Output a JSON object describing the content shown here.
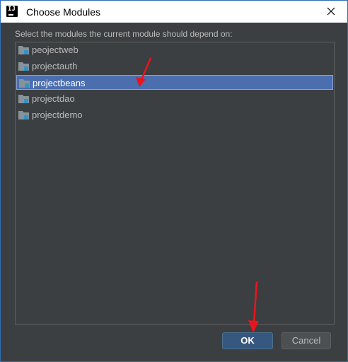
{
  "window": {
    "title": "Choose Modules",
    "app_icon_letter": "IJ"
  },
  "dialog": {
    "instruction": "Select the modules the current module should depend on:",
    "modules": [
      {
        "label": "peojectweb",
        "selected": false
      },
      {
        "label": "projectauth",
        "selected": false
      },
      {
        "label": "projectbeans",
        "selected": true
      },
      {
        "label": "projectdao",
        "selected": false
      },
      {
        "label": "projectdemo",
        "selected": false
      }
    ],
    "ok_label": "OK",
    "cancel_label": "Cancel"
  },
  "colors": {
    "background": "#3c3f41",
    "selection": "#4b6eaf",
    "text": "#bbbbbb",
    "ok_button": "#365880",
    "annotation_arrow": "#e8161c",
    "folder_icon": "#87939a",
    "module_marker": "#3592c4"
  },
  "icons": {
    "module": "module-folder-icon",
    "close": "close-icon",
    "app": "intellij-idea-icon"
  }
}
